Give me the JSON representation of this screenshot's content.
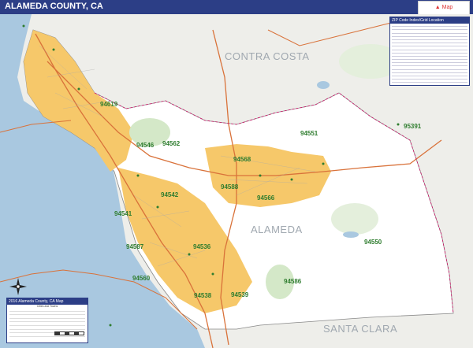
{
  "header": {
    "title": "ALAMEDA COUNTY, CA"
  },
  "map_labels": {
    "counties": {
      "contra_costa": "CONTRA COSTA",
      "alameda": "ALAMEDA",
      "santa_clara": "SANTA CLARA"
    },
    "zips": {
      "z94619": "94619",
      "z94546": "94546",
      "z94562": "94562",
      "z94551": "94551",
      "z95391": "95391",
      "z94568": "94568",
      "z94588": "94588",
      "z94566": "94566",
      "z94542": "94542",
      "z94541": "94541",
      "z94587": "94587",
      "z94536": "94536",
      "z94550": "94550",
      "z94586": "94586",
      "z94560": "94560",
      "z94538": "94538",
      "z94539": "94539"
    }
  },
  "zip_index": {
    "title": "ZIP Code Index/Grid Location",
    "rows": 20
  },
  "legend": {
    "title": "2016 Alameda County, CA Map",
    "subtitle": "Cities and Towns",
    "rows": 8
  },
  "colors": {
    "water": "#a9c8e0",
    "land": "#ffffff",
    "urban": "#f6c86a",
    "park": "#d4e8c8",
    "neighbor": "#eeeeea",
    "header": "#2c3e86",
    "road": "#d9723a",
    "zip_text": "#2f7d2f"
  }
}
